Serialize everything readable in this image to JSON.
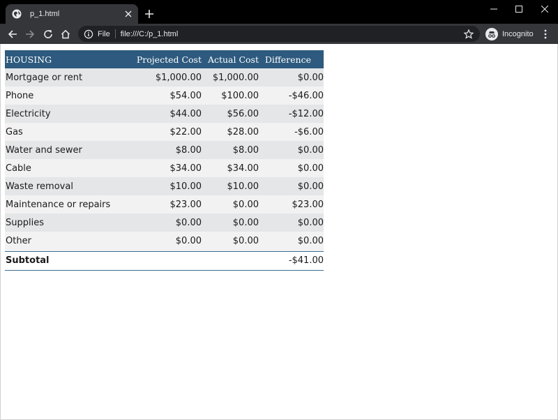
{
  "browser": {
    "tab_title": "p_1.html",
    "address_scheme": "File",
    "address_url": "file:///C:/p_1.html",
    "profile_label": "Incognito"
  },
  "table": {
    "headers": [
      "HOUSING",
      "Projected Cost",
      "Actual Cost",
      "Difference"
    ],
    "rows": [
      {
        "name": "Mortgage or rent",
        "projected": "$1,000.00",
        "actual": "$1,000.00",
        "difference": "$0.00"
      },
      {
        "name": "Phone",
        "projected": "$54.00",
        "actual": "$100.00",
        "difference": "-$46.00"
      },
      {
        "name": "Electricity",
        "projected": "$44.00",
        "actual": "$56.00",
        "difference": "-$12.00"
      },
      {
        "name": "Gas",
        "projected": "$22.00",
        "actual": "$28.00",
        "difference": "-$6.00"
      },
      {
        "name": "Water and sewer",
        "projected": "$8.00",
        "actual": "$8.00",
        "difference": "$0.00"
      },
      {
        "name": "Cable",
        "projected": "$34.00",
        "actual": "$34.00",
        "difference": "$0.00"
      },
      {
        "name": "Waste removal",
        "projected": "$10.00",
        "actual": "$10.00",
        "difference": "$0.00"
      },
      {
        "name": "Maintenance or repairs",
        "projected": "$23.00",
        "actual": "$0.00",
        "difference": "$23.00"
      },
      {
        "name": "Supplies",
        "projected": "$0.00",
        "actual": "$0.00",
        "difference": "$0.00"
      },
      {
        "name": "Other",
        "projected": "$0.00",
        "actual": "$0.00",
        "difference": "$0.00"
      }
    ],
    "subtotal": {
      "label": "Subtotal",
      "projected": "",
      "actual": "",
      "difference": "-$41.00"
    }
  },
  "colors": {
    "header_bg": "#2d5a7e",
    "row_odd_bg": "#e4e6e8",
    "row_even_bg": "#f2f2f2",
    "rule": "#3d6f92"
  },
  "icons": [
    "globe-favicon-icon",
    "close-icon",
    "plus-icon",
    "minimize-icon",
    "maximize-icon",
    "window-close-icon",
    "back-arrow-icon",
    "forward-arrow-icon",
    "reload-icon",
    "home-icon",
    "info-icon",
    "star-icon",
    "incognito-icon",
    "kebab-menu-icon"
  ]
}
